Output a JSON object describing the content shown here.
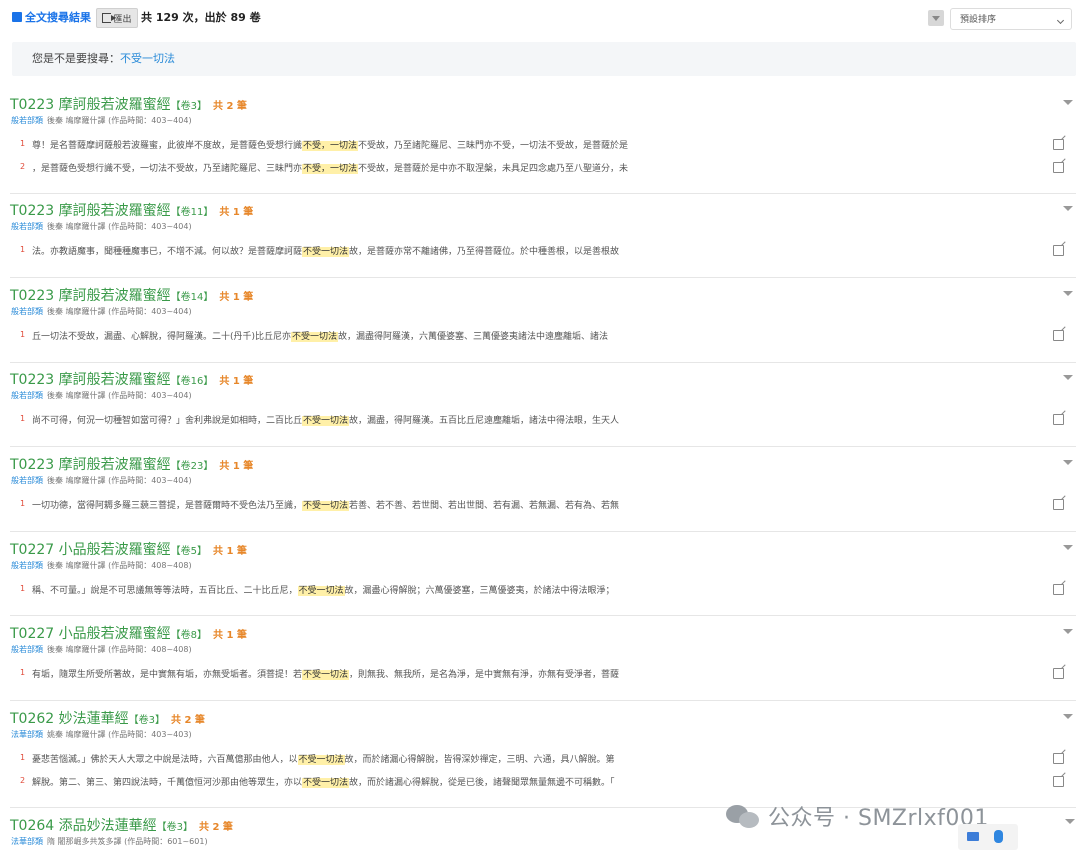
{
  "header": {
    "title": "全文搜尋結果",
    "export_label": "匯出",
    "count_text": "共 129 次，出於 89 卷",
    "sort_label": "預設排序"
  },
  "suggestion": {
    "prompt": "您是不是要搜尋：",
    "term": "不受一切法"
  },
  "results": [
    {
      "title": "T0223 摩訶般若波羅蜜經",
      "volume": "【卷3】",
      "count": "共 2 筆",
      "category": "般若部類",
      "meta": "後秦 鳩摩羅什譯 (作品時間：403~404)",
      "lines": [
        {
          "num": "1",
          "pre": "尊！是名菩薩摩訶薩般若波羅蜜，此彼岸不度故，是菩薩色受想行識",
          "hl": "不受，一切法",
          "post": "不受故，乃至諸陀羅尼、三昧門亦不受，一切法不受故，是菩薩於是"
        },
        {
          "num": "2",
          "pre": "，是菩薩色受想行識不受，一切法不受故，乃至諸陀羅尼、三昧門亦",
          "hl": "不受，一切法",
          "post": "不受故，是菩薩於是中亦不取涅槃，未具足四念處乃至八聖道分，未"
        }
      ]
    },
    {
      "title": "T0223 摩訶般若波羅蜜經",
      "volume": "【卷11】",
      "count": "共 1 筆",
      "category": "般若部類",
      "meta": "後秦 鳩摩羅什譯 (作品時間：403~404)",
      "lines": [
        {
          "num": "1",
          "pre": "法。亦教語魔事，聞種種魔事已，不增不減。何以故？是菩薩摩訶薩",
          "hl": "不受一切法",
          "post": "故，是菩薩亦常不離諸佛，乃至得菩薩位。於中種善根，以是善根故"
        }
      ]
    },
    {
      "title": "T0223 摩訶般若波羅蜜經",
      "volume": "【卷14】",
      "count": "共 1 筆",
      "category": "般若部類",
      "meta": "後秦 鳩摩羅什譯 (作品時間：403~404)",
      "lines": [
        {
          "num": "1",
          "pre": "丘一切法不受故，漏盡、心解脫，得阿羅漢。二十(丹千)比丘尼亦",
          "hl": "不受一切法",
          "post": "故，漏盡得阿羅漢，六萬優婆塞、三萬優婆夷諸法中遠塵離垢、諸法"
        }
      ]
    },
    {
      "title": "T0223 摩訶般若波羅蜜經",
      "volume": "【卷16】",
      "count": "共 1 筆",
      "category": "般若部類",
      "meta": "後秦 鳩摩羅什譯 (作品時間：403~404)",
      "lines": [
        {
          "num": "1",
          "pre": "尚不可得，何況一切種智如當可得？」舍利弗說是如相時，二百比丘",
          "hl": "不受一切法",
          "post": "故，漏盡，得阿羅漢。五百比丘尼遠塵離垢，諸法中得法眼，生天人"
        }
      ]
    },
    {
      "title": "T0223 摩訶般若波羅蜜經",
      "volume": "【卷23】",
      "count": "共 1 筆",
      "category": "般若部類",
      "meta": "後秦 鳩摩羅什譯 (作品時間：403~404)",
      "lines": [
        {
          "num": "1",
          "pre": "一切功德，當得阿耨多羅三藐三菩提，是菩薩爾時不受色法乃至識，",
          "hl": "不受一切法",
          "post": "若善、若不善、若世間、若出世間、若有漏、若無漏、若有為、若無"
        }
      ]
    },
    {
      "title": "T0227 小品般若波羅蜜經",
      "volume": "【卷5】",
      "count": "共 1 筆",
      "category": "般若部類",
      "meta": "後秦 鳩摩羅什譯 (作品時間：408~408)",
      "lines": [
        {
          "num": "1",
          "pre": "稱、不可量。」說是不可思議無等等法時，五百比丘、二十比丘尼，",
          "hl": "不受一切法",
          "post": "故，漏盡心得解脫；六萬優婆塞，三萬優婆夷，於諸法中得法眼淨；"
        }
      ]
    },
    {
      "title": "T0227 小品般若波羅蜜經",
      "volume": "【卷8】",
      "count": "共 1 筆",
      "category": "般若部類",
      "meta": "後秦 鳩摩羅什譯 (作品時間：408~408)",
      "lines": [
        {
          "num": "1",
          "pre": "有垢，隨眾生所受所著故，是中實無有垢，亦無受垢者。須菩提！若",
          "hl": "不受一切法",
          "post": "，則無我、無我所，是名為淨，是中實無有淨，亦無有受淨者，菩薩"
        }
      ]
    },
    {
      "title": "T0262 妙法蓮華經",
      "volume": "【卷3】",
      "count": "共 2 筆",
      "category": "法華部類",
      "meta": "姚秦 鳩摩羅什譯 (作品時間：403~403)",
      "lines": [
        {
          "num": "1",
          "pre": "憂悲苦惱滅。」佛於天人大眾之中說是法時，六百萬億那由他人，以",
          "hl": "不受一切法",
          "post": "故，而於諸漏心得解脫，皆得深妙禪定，三明、六通，具八解脫。第"
        },
        {
          "num": "2",
          "pre": "解脫。第二、第三、第四說法時，千萬億恒河沙那由他等眾生，亦以",
          "hl": "不受一切法",
          "post": "故，而於諸漏心得解脫，從是已後，諸聲聞眾無量無邊不可稱數。「"
        }
      ]
    },
    {
      "title": "T0264 添品妙法蓮華經",
      "volume": "【卷3】",
      "count": "共 2 筆",
      "category": "法華部類",
      "meta": "隋 闍那崛多共笈多譯 (作品時間：601~601)",
      "lines": []
    }
  ],
  "watermark": "公众号 · SMZrlxf001"
}
